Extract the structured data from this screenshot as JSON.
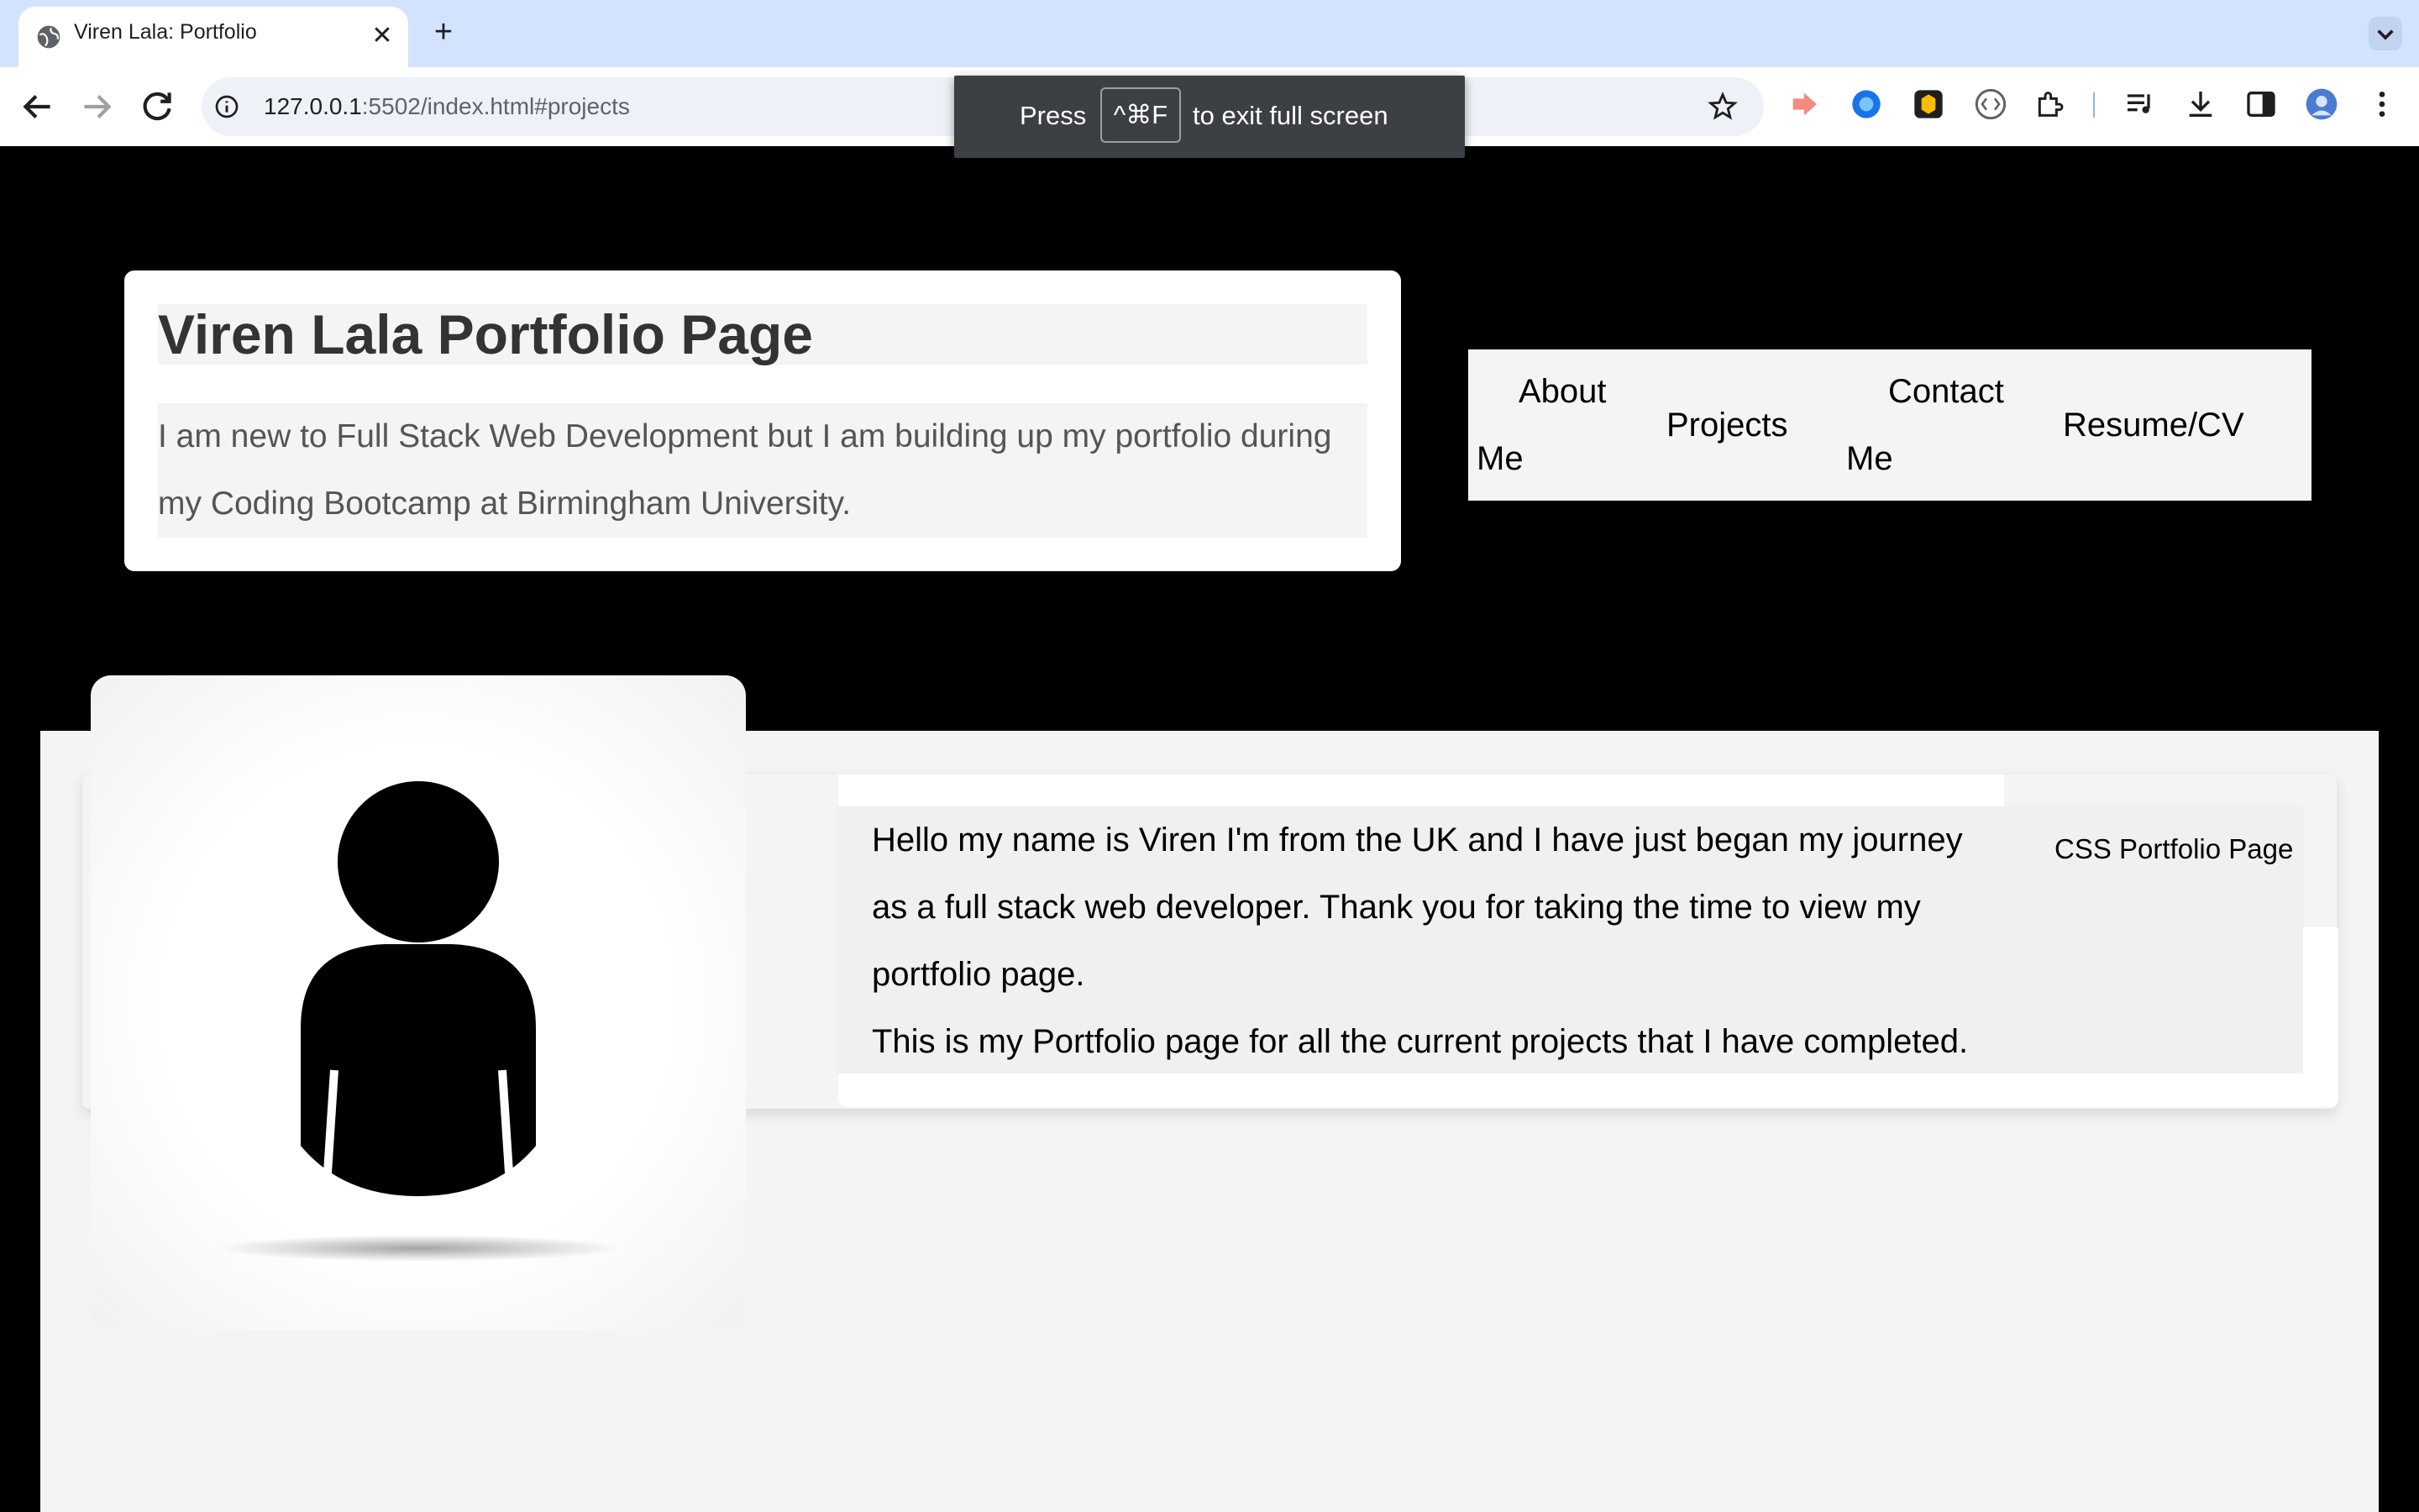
{
  "browser": {
    "tab_title": "Viren Lala: Portfolio",
    "tab_close": "✕",
    "new_tab": "+",
    "url_host": "127.0.0.1",
    "url_rest": ":5502/index.html#projects",
    "icons": [
      "back-icon",
      "forward-icon",
      "reload-icon",
      "site-info-icon",
      "bookmark-star-icon"
    ]
  },
  "fullscreen_toast": {
    "press": "Press",
    "key": "^⌘F",
    "exit": "to exit full screen"
  },
  "header": {
    "title": "Viren Lala Portfolio Page",
    "description": "I am new to Full Stack Web Development but I am building up my portfolio during my Coding Bootcamp at Birmingham University."
  },
  "nav": {
    "about_1": "About",
    "about_2": "Me",
    "projects": "Projects",
    "contact_1": "Contact",
    "contact_2": "Me",
    "resume": "Resume/CV"
  },
  "about": {
    "paragraph_1": "Hello my name is Viren I'm from the UK and I have just began my journey as a full stack web developer. Thank you for taking the time to view my portfolio page.",
    "paragraph_2": "This is my Portfolio page for all the current projects that I have completed.",
    "side_link": "CSS Portfolio Page"
  },
  "colors": {
    "tab_strip": "#d3e3fd",
    "page_background": "#000000",
    "card_background": "#ffffff",
    "section_background": "#f4f4f4"
  }
}
